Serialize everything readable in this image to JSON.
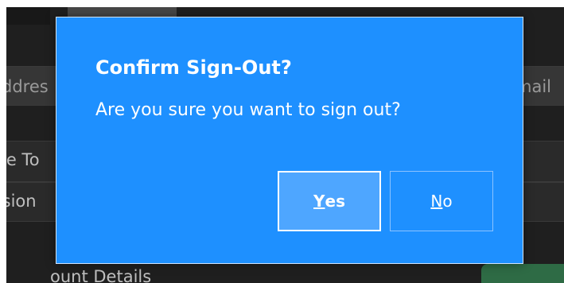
{
  "background": {
    "address_fragment": "ddres",
    "email_fragment": "mail",
    "toggle_fragment": "le To",
    "version_fragment": "rsion",
    "account_fragment": "ount Details"
  },
  "dialog": {
    "title": "Confirm Sign-Out?",
    "message": "Are you sure you want to sign out?",
    "yes_mnemonic": "Y",
    "yes_rest": "es",
    "no_mnemonic": "N",
    "no_rest": "o"
  },
  "colors": {
    "dialog_bg": "#1e90ff",
    "yes_bg": "#4ea6ff",
    "window_bg": "#1f1f1f"
  }
}
